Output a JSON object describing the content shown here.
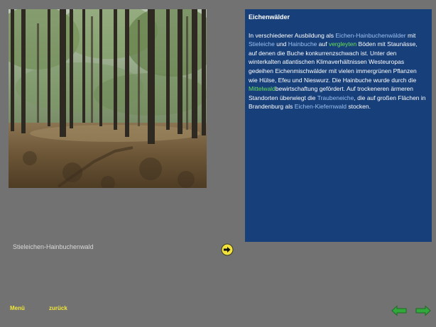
{
  "photo": {
    "alt": "Traubeneichen-Hainbuchenwald"
  },
  "caption": "Stieleichen-Hainbuchenwald",
  "panel": {
    "title": "Eichenwälder",
    "parts": {
      "p1": "In verschiedener Ausbildung als ",
      "l1": "Eichen-Hainbuchenwälder",
      "p2": " mit ",
      "l2": "Stieleiche",
      "p3": " und ",
      "l3": "Hainbuche",
      "p4": " auf ",
      "l4": "vergleyten",
      "p5": " Böden mit Staunässe, auf denen die Buche konkurrenzschwach ist. Unter den winterkalten atlantischen Klimaverhältnissen Westeuropas gedeihen Eichenmischwälder mit vielen immergrünen Pflanzen wie Hülse, Efeu und Nieswurz. Die Hainbuche wurde durch die ",
      "l5": "Mittelwald",
      "p6": "bewirtschaftung gefördert. Auf trockeneren ärmeren Standorten überwiegt die ",
      "l6": "Traubeneiche",
      "p7": ", die auf großen Flächen in Brandenburg als ",
      "l7": "Eichen-Kiefernwald",
      "p8": " stocken."
    }
  },
  "footer": {
    "menu_label": "Menü",
    "back_label": "zurück"
  },
  "icons": {
    "next": "arrow-right-circle-icon",
    "prev_page": "arrow-left-icon",
    "next_page": "arrow-right-icon"
  },
  "colors": {
    "background": "#727272",
    "panel": "#173f7a",
    "link_blue": "#9dc1f2",
    "link_green": "#69e05a",
    "footer_text": "#f0e63a",
    "nav_arrow": "#31a83a",
    "next_button": "#f2e23d"
  }
}
